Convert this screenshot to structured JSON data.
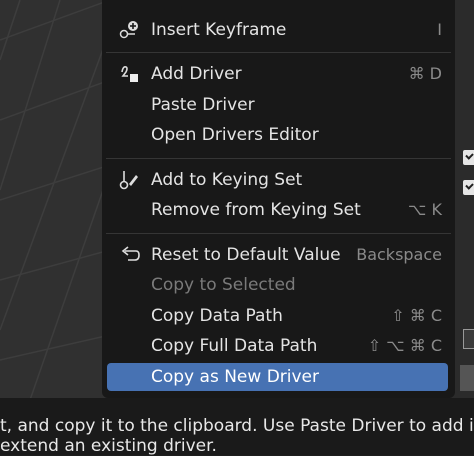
{
  "menu": {
    "items": [
      {
        "label": "Insert Keyframe",
        "shortcut": "I",
        "icon": "insert-keyframe-icon"
      },
      {
        "label": "Add Driver",
        "shortcut": "⌘ D",
        "icon": "driver-icon"
      },
      {
        "label": "Paste Driver",
        "shortcut": ""
      },
      {
        "label": "Open Drivers Editor",
        "shortcut": ""
      },
      {
        "label": "Add to Keying Set",
        "shortcut": "",
        "icon": "keying-set-icon"
      },
      {
        "label": "Remove from Keying Set",
        "shortcut": "⌥ K"
      },
      {
        "label": "Reset to Default Value",
        "shortcut": "Backspace",
        "icon": "reset-icon"
      },
      {
        "label": "Copy to Selected",
        "shortcut": "",
        "disabled": true
      },
      {
        "label": "Copy Data Path",
        "shortcut": "⇧ ⌘ C"
      },
      {
        "label": "Copy Full Data Path",
        "shortcut": "⇧ ⌥ ⌘ C"
      },
      {
        "label": "Copy as New Driver",
        "shortcut": "",
        "active": true
      }
    ]
  },
  "tooltip": {
    "line1": "t, and copy it to the clipboard. Use Paste Driver to add it t",
    "line2": "extend an existing driver."
  },
  "colors": {
    "menu_bg": "#181818",
    "highlight": "#4772b3",
    "text": "#e4e4e4",
    "disabled_text": "#7a7a7a",
    "shortcut_text": "#8a8a8a"
  }
}
